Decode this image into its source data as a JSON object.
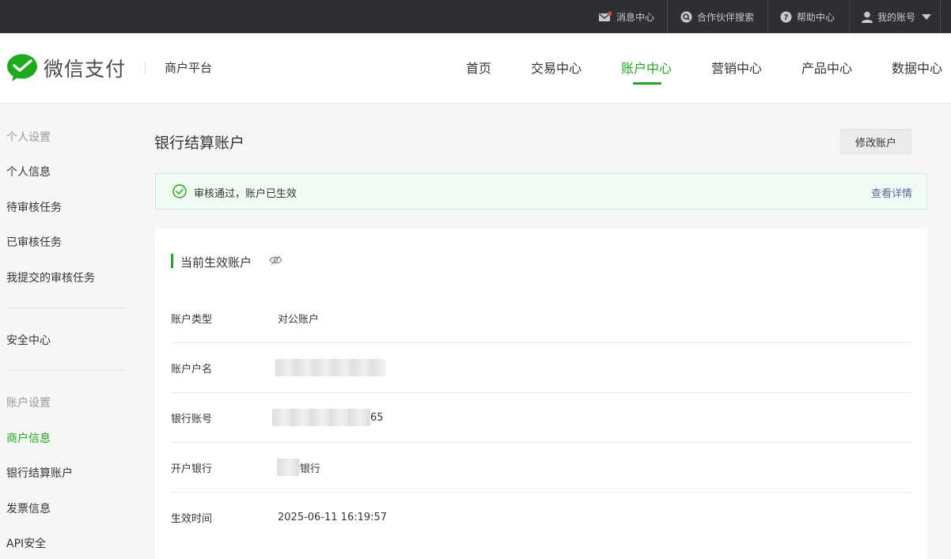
{
  "topbar": {
    "items": [
      {
        "label": "消息中心",
        "icon": "mail-icon"
      },
      {
        "label": "合作伙伴搜索",
        "icon": "search-circle-icon"
      },
      {
        "label": "帮助中心",
        "icon": "help-icon"
      },
      {
        "label": "我的账号",
        "icon": "user-icon"
      }
    ],
    "notification_color": "#e64340"
  },
  "header": {
    "logo_text": "微信支付",
    "platform_label": "商户平台",
    "nav": [
      "首页",
      "交易中心",
      "账户中心",
      "营销中心",
      "产品中心",
      "数据中心"
    ],
    "active_nav": "账户中心",
    "accent_color": "#1aad19"
  },
  "sidebar": {
    "personal_heading": "个人设置",
    "personal_items": [
      "个人信息",
      "待审核任务",
      "已审核任务",
      "我提交的审核任务"
    ],
    "security_item": "安全中心",
    "account_heading": "账户设置",
    "account_items": [
      "商户信息",
      "银行结算账户",
      "发票信息",
      "API安全"
    ],
    "active_item": "商户信息"
  },
  "main": {
    "title": "银行结算账户",
    "modify_button": "修改账户",
    "notice": {
      "text": "审核通过，账户已生效",
      "link": "查看详情",
      "icon": "check-circle-icon"
    },
    "card": {
      "title": "当前生效账户",
      "toggle_icon": "eye-hidden-icon",
      "rows": [
        {
          "label": "账户类型",
          "value": "对公账户"
        },
        {
          "label": "账户户名",
          "value": ""
        },
        {
          "label": "银行账号",
          "value": "65"
        },
        {
          "label": "开户银行",
          "value": "银行"
        },
        {
          "label": "生效时间",
          "value": "2025-06-11 16:19:57"
        }
      ]
    }
  }
}
